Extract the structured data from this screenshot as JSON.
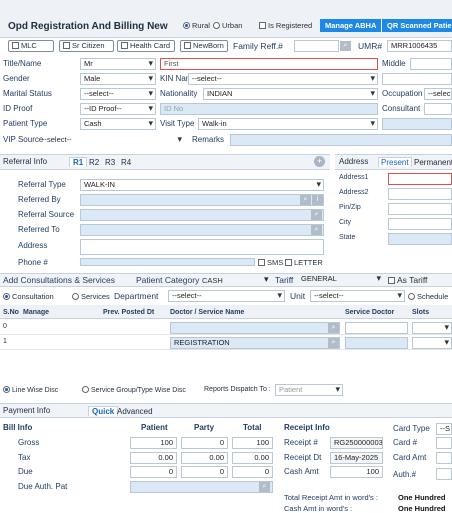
{
  "title": "Opd Registration And Billing New",
  "area": {
    "rural": "Rural",
    "urban": "Urban"
  },
  "is_registered": "Is Registered",
  "manage_abha": "Manage ABHA",
  "qr_scanned": "QR Scanned Patient",
  "flags": {
    "mlc": "MLC",
    "sr_citizen": "Sr Citizen",
    "health_card": "Health Card",
    "newborn": "NewBorn"
  },
  "family_ref": "Family Reff.#",
  "umr_label": "UMR#",
  "umr_value": "MRR1006435",
  "patient": {
    "title_label": "Title/Name",
    "title_value": "Mr",
    "first_placeholder": "First",
    "middle_label": "Middle",
    "gender_label": "Gender",
    "gender_value": "Male",
    "kin_label": "KIN Name",
    "kin_value": "--select--",
    "marital_label": "Marital Status",
    "marital_value": "--select--",
    "nationality_label": "Nationality",
    "nationality_value": "INDIAN",
    "occupation_label": "Occupation",
    "occupation_value": "--select",
    "idproof_label": "ID Proof",
    "idproof_value": "--ID Proof--",
    "idno_placeholder": "ID No",
    "consultant_label": "Consultant",
    "ptype_label": "Patient Type",
    "ptype_value": "Cash",
    "visit_label": "Visit Type",
    "visit_value": "Walk-in",
    "vip_label": "VIP Source",
    "vip_value": "--select--",
    "remarks_label": "Remarks"
  },
  "referral": {
    "tab": "Referral Info",
    "r1": "R1",
    "r2": "R2",
    "r3": "R3",
    "r4": "R4",
    "type_label": "Referral Type",
    "type_value": "WALK-IN",
    "by_label": "Referred By",
    "source_label": "Referral Source",
    "to_label": "Referred To",
    "address_label": "Address",
    "phone_label": "Phone #",
    "sms": "SMS",
    "letter": "LETTER"
  },
  "address": {
    "tab": "Address",
    "present": "Present",
    "permanent": "Permanent",
    "address1": "Address1",
    "address2": "Address2",
    "pin": "Pin/Zip",
    "city": "City",
    "state": "State"
  },
  "consult": {
    "title": "Add Consultations & Services",
    "category_label": "Patient Category",
    "category_value": "CASH",
    "tariff_label": "Tariff",
    "tariff_value": "GENERAL",
    "as_tariff": "As Tariff",
    "consultation": "Consultation",
    "services": "Services",
    "department_label": "Department",
    "department_value": "--select--",
    "unit_label": "Unit",
    "unit_value": "--select--",
    "schedule": "Schedule",
    "columns": [
      "S.No",
      "Manage",
      "Prev. Posted Dt",
      "Doctor / Service Name",
      "Service Doctor",
      "Slots"
    ],
    "rows": [
      {
        "sno": "0",
        "service": ""
      },
      {
        "sno": "1",
        "service": "REGISTRATION"
      }
    ],
    "line_wise": "Line Wise Disc",
    "group_wise": "Service Group/Type Wise Disc",
    "dispatch_label": "Reports Dispatch To :",
    "dispatch_value": "Patient"
  },
  "payment": {
    "tab1": "Payment Info",
    "tab2": "Quick",
    "tab3": "Advanced",
    "bill_info": "Bill Info",
    "patient_col": "Patient",
    "party_col": "Party",
    "total_col": "Total",
    "rows": [
      {
        "label": "Gross",
        "patient": "100",
        "party": "0",
        "total": "100"
      },
      {
        "label": "Tax",
        "patient": "0.00",
        "party": "0.00",
        "total": "0.00"
      },
      {
        "label": "Due",
        "patient": "0",
        "party": "0",
        "total": "0"
      }
    ],
    "due_auth": "Due Auth. Pat",
    "receipt_info": "Receipt Info",
    "receipt_no_label": "Receipt #",
    "receipt_no": "RG250000003",
    "receipt_dt_label": "Receipt Dt",
    "receipt_dt": "16-May-2025",
    "cash_amt_label": "Cash Amt",
    "cash_amt": "100",
    "card_type_label": "Card Type",
    "card_type_value": "--S",
    "card_no_label": "Card #",
    "card_amt_label": "Card Amt",
    "auth_label": "Auth.#",
    "total_words_label": "Total Receipt Amt in word's :",
    "total_words": "One Hundred",
    "cash_words_label": "Cash Amt in word's :",
    "cash_words": "One Hundred"
  }
}
